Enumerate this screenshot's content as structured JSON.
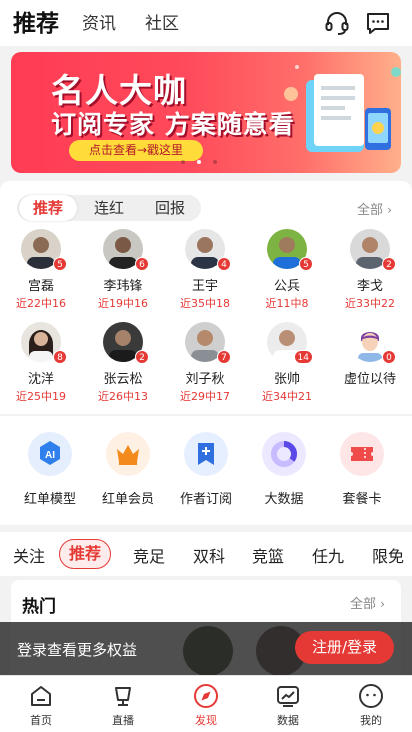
{
  "top_tabs": [
    {
      "label": "推荐",
      "active": true
    },
    {
      "label": "资讯",
      "active": false
    },
    {
      "label": "社区",
      "active": false
    }
  ],
  "banner": {
    "line1": "名人大咖",
    "line2": "订阅专家 方案随意看",
    "cta": "点击查看→戳这里",
    "slide_count": 3,
    "active_slide": 2
  },
  "experts_section": {
    "tabs": [
      "推荐",
      "连红",
      "回报"
    ],
    "active_tab": "推荐",
    "all_label": "全部",
    "experts": [
      {
        "name": "宫磊",
        "badge": "5",
        "record": "近22中16"
      },
      {
        "name": "李玮锋",
        "badge": "6",
        "record": "近19中16"
      },
      {
        "name": "王宇",
        "badge": "4",
        "record": "近35中18"
      },
      {
        "name": "公兵",
        "badge": "5",
        "record": "近11中8"
      },
      {
        "name": "李戈",
        "badge": "2",
        "record": "近33中22"
      },
      {
        "name": "沈洋",
        "badge": "8",
        "record": "近25中19"
      },
      {
        "name": "张云松",
        "badge": "2",
        "record": "近26中13"
      },
      {
        "name": "刘子秋",
        "badge": "7",
        "record": "近29中17"
      },
      {
        "name": "张帅",
        "badge": "14",
        "record": "近34中21"
      },
      {
        "name": "虚位以待",
        "badge": "0",
        "record": ""
      }
    ]
  },
  "features": [
    {
      "label": "红单模型",
      "icon": "ai-icon"
    },
    {
      "label": "红单会员",
      "icon": "crown-icon"
    },
    {
      "label": "作者订阅",
      "icon": "bookmark-plus-icon"
    },
    {
      "label": "大数据",
      "icon": "donut-chart-icon"
    },
    {
      "label": "套餐卡",
      "icon": "ticket-icon"
    }
  ],
  "category_tabs": [
    "关注",
    "推荐",
    "竞足",
    "双科",
    "竞篮",
    "任九",
    "限免"
  ],
  "active_category": "推荐",
  "hot_section": {
    "title": "热门",
    "all_label": "全部"
  },
  "login_bar": {
    "message": "登录查看更多权益",
    "button": "注册/登录"
  },
  "bottom_nav": [
    {
      "label": "首页",
      "icon": "home-icon",
      "active": false
    },
    {
      "label": "直播",
      "icon": "live-tv-icon",
      "active": false
    },
    {
      "label": "发现",
      "icon": "compass-icon",
      "active": true
    },
    {
      "label": "数据",
      "icon": "chart-icon",
      "active": false
    },
    {
      "label": "我的",
      "icon": "profile-icon",
      "active": false
    }
  ],
  "colors": {
    "accent": "#e53935",
    "badge": "#e53935",
    "cta": "#ffdc3a"
  }
}
